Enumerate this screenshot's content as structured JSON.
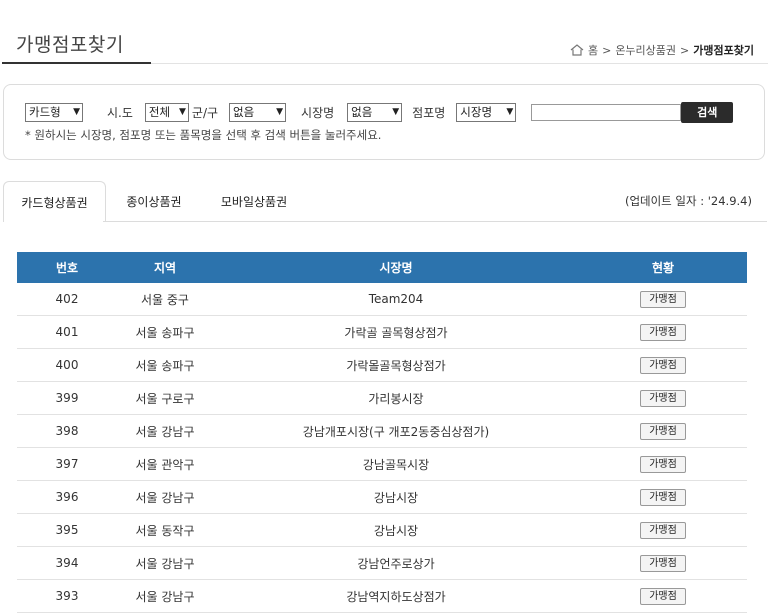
{
  "page": {
    "title": "가맹점포찾기",
    "breadcrumb": [
      "홈",
      "온누리상품권",
      "가맹점포찾기"
    ]
  },
  "search": {
    "type_select": "카드형",
    "sido_label": "시.도",
    "sido_select": "전체",
    "gugun_label": "군/구",
    "gugun_select": "없음",
    "market_label": "시장명",
    "market_select": "없음",
    "store_label": "점포명",
    "store_select": "시장명",
    "input_value": "",
    "button_label": "검색",
    "hint": "* 원하시는 시장명, 점포명 또는 품목명을 선택 후 검색 버튼을 눌러주세요."
  },
  "tabs": [
    "카드형상품권",
    "종이상품권",
    "모바일상품권"
  ],
  "update_text": "(업데이트 일자 : '24.9.4)",
  "table": {
    "headers": [
      "번호",
      "지역",
      "시장명",
      "현황"
    ],
    "rows": [
      {
        "no": "402",
        "region": "서울 중구",
        "market": "Team204",
        "status": "가맹점"
      },
      {
        "no": "401",
        "region": "서울 송파구",
        "market": "가락골 골목형상점가",
        "status": "가맹점"
      },
      {
        "no": "400",
        "region": "서울 송파구",
        "market": "가락몰골목형상점가",
        "status": "가맹점"
      },
      {
        "no": "399",
        "region": "서울 구로구",
        "market": "가리봉시장",
        "status": "가맹점"
      },
      {
        "no": "398",
        "region": "서울 강남구",
        "market": "강남개포시장(구 개포2동중심상점가)",
        "status": "가맹점"
      },
      {
        "no": "397",
        "region": "서울 관악구",
        "market": "강남골목시장",
        "status": "가맹점"
      },
      {
        "no": "396",
        "region": "서울 강남구",
        "market": "강남시장",
        "status": "가맹점"
      },
      {
        "no": "395",
        "region": "서울 동작구",
        "market": "강남시장",
        "status": "가맹점"
      },
      {
        "no": "394",
        "region": "서울 강남구",
        "market": "강남언주로상가",
        "status": "가맹점"
      },
      {
        "no": "393",
        "region": "서울 강남구",
        "market": "강남역지하도상점가",
        "status": "가맹점"
      }
    ]
  }
}
